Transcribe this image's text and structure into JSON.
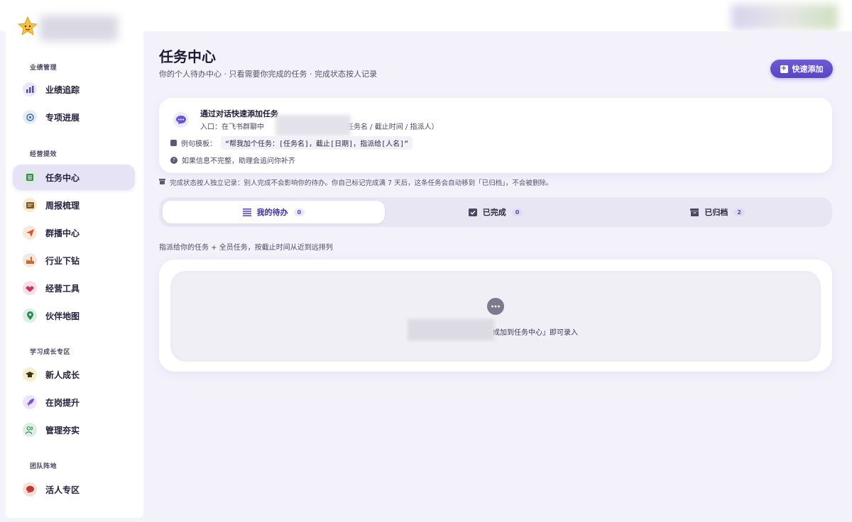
{
  "sidebar": {
    "groups": [
      {
        "label": "业绩管理"
      },
      {
        "label": "经营提效"
      },
      {
        "label": "学习成长专区"
      },
      {
        "label": "团队阵地"
      }
    ],
    "items": [
      {
        "label": "业绩追踪",
        "icon": "bar-chart-icon",
        "color": "#5a46c2"
      },
      {
        "label": "专项进展",
        "icon": "target-icon",
        "color": "#3f6fa8"
      },
      {
        "label": "任务中心",
        "icon": "list-icon",
        "color": "#2f8a5a"
      },
      {
        "label": "周报梳理",
        "icon": "report-icon",
        "color": "#c07a22"
      },
      {
        "label": "群播中心",
        "icon": "send-icon",
        "color": "#d0582a"
      },
      {
        "label": "行业下钻",
        "icon": "factory-icon",
        "color": "#c76a2e"
      },
      {
        "label": "经营工具",
        "icon": "handshake-icon",
        "color": "#c23a5a"
      },
      {
        "label": "伙伴地图",
        "icon": "map-pin-icon",
        "color": "#2f8a5a"
      },
      {
        "label": "新人成长",
        "icon": "graduation-cap-icon",
        "color": "#c9a028"
      },
      {
        "label": "在岗提升",
        "icon": "rocket-icon",
        "color": "#7a56c8"
      },
      {
        "label": "管理夯实",
        "icon": "people-icon",
        "color": "#2f8a5a"
      },
      {
        "label": "活人专区",
        "icon": "speech-bubble-icon",
        "color": "#c0392b"
      }
    ]
  },
  "header": {
    "title": "任务中心",
    "subtitle": "你的个人待办中心 · 只看需要你完成的任务 · 完成状态按人记录",
    "quick_add_label": "快速添加"
  },
  "dialog_card": {
    "title": "通过对话快速添加任务",
    "entry_prefix": "入口：在飞书群聊中",
    "entry_suffix": "息（任务名 / 截止时间 / 指派人）",
    "template_label": "例句模板：",
    "template_value": "“帮我加个任务：[任务名]，截止[日期]，指派给[人名]”",
    "incomplete_hint": "如果信息不完整，助理会追问你补齐"
  },
  "notice": "完成状态按人独立记录：别人完成不会影响你的待办。你自己标记完成满 7 天后，这条任务会自动移到「已归档」，不会被删除。",
  "tabs": [
    {
      "label": "我的待办",
      "count": "0",
      "icon": "list-icon"
    },
    {
      "label": "已完成",
      "count": "0",
      "icon": "check-box-icon"
    },
    {
      "label": "已归档",
      "count": "2",
      "icon": "archive-icon"
    }
  ],
  "sort_note": "指派给你的任务 + 全员任务，按截止时间从近到远排列",
  "empty_state": {
    "text": "成加到任务中心」即可录入"
  },
  "colors": {
    "accent": "#5a46c2",
    "background": "#f3f2fb"
  }
}
